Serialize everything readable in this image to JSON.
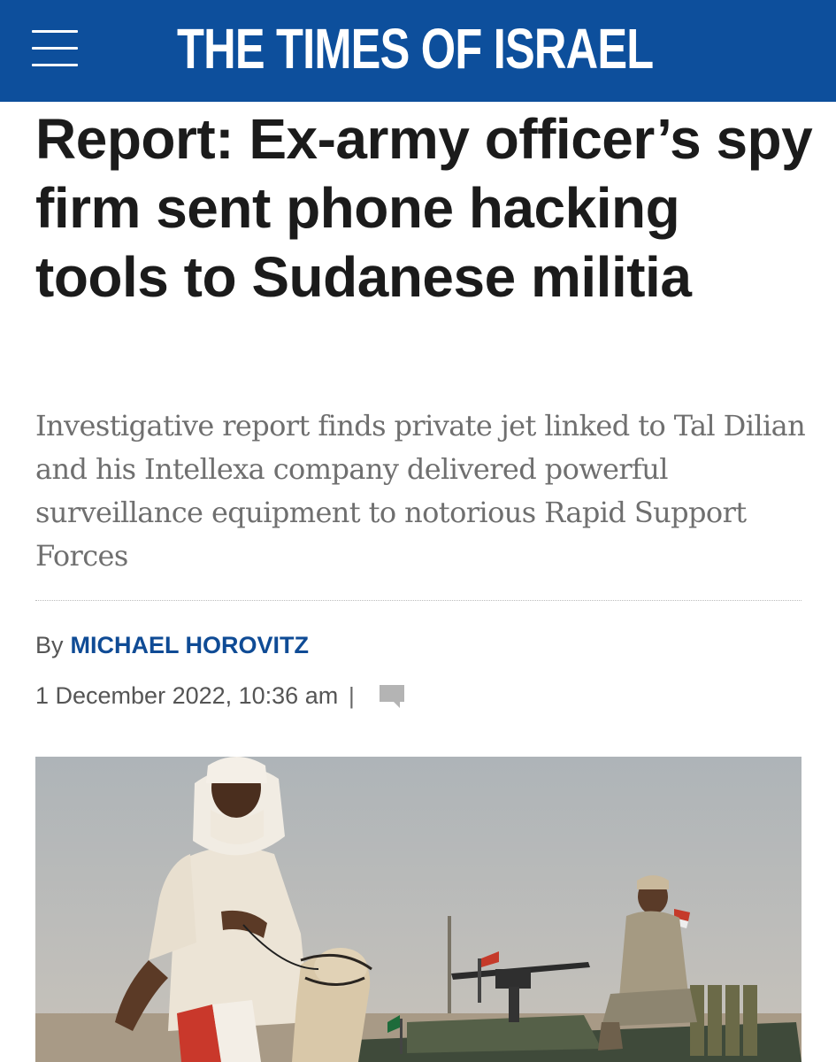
{
  "site": {
    "logo_text": "THE TIMES OF ISRAEL",
    "brand_color": "#0d4f9c"
  },
  "icons": {
    "menu": "hamburger-menu-icon",
    "comments": "comment-icon"
  },
  "article": {
    "headline": "Report: Ex-army officer’s spy firm sent phone hacking tools to Sudanese militia",
    "subheadline": "Investigative report finds private jet linked to Tal Dilian and his Intellexa company delivered powerful surveillance equipment to notorious Rapid Support Forces",
    "byline_prefix": "By",
    "author": "MICHAEL HOROVITZ",
    "author_color": "#0f4b95",
    "date": "1 December 2022, 10:36 am",
    "separator": "|"
  }
}
